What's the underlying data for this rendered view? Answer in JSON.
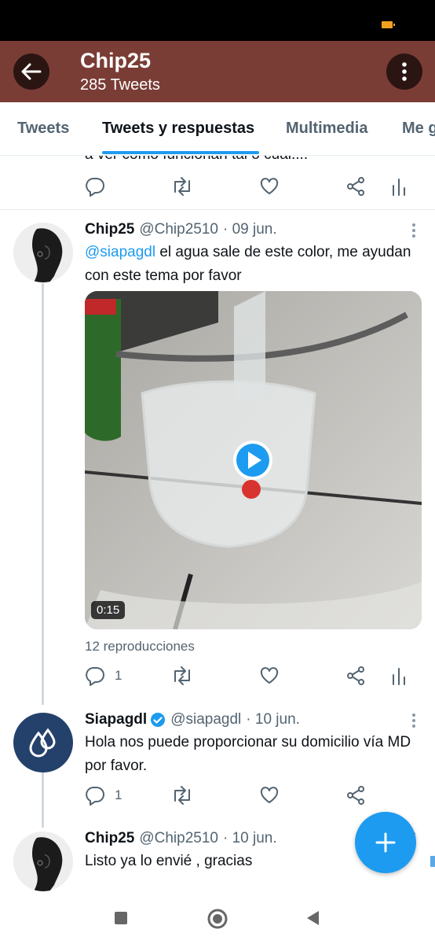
{
  "header": {
    "title": "Chip25",
    "subtitle": "285 Tweets",
    "bg_color": "#7a3d36"
  },
  "tabs": [
    {
      "label": "Tweets",
      "active": false
    },
    {
      "label": "Tweets y respuestas",
      "active": true
    },
    {
      "label": "Multimedia",
      "active": false
    },
    {
      "label": "Me g",
      "active": false
    }
  ],
  "prev_tweet": {
    "cut_text": "a ver como funcionan tal o cual...."
  },
  "tweets": [
    {
      "name": "Chip25",
      "handle": "@Chip2510",
      "date": "· 09 jun.",
      "mention": "@siapagdl",
      "text": " el agua sale de este color, me ayudan con este tema por favor",
      "video_duration": "0:15",
      "views": "12 reproducciones",
      "reply_count": "1"
    },
    {
      "name": "Siapagdl",
      "handle": "@siapagdl",
      "date": "· 10 jun.",
      "verified": true,
      "text": "Hola nos puede proporcionar su domicilio vía MD por favor.",
      "reply_count": "1"
    },
    {
      "name": "Chip25",
      "handle": "@Chip2510",
      "date": "· 10 jun.",
      "text": "Listo ya lo envié , gracias"
    }
  ],
  "colors": {
    "accent": "#1d9bf0",
    "secondary_text": "#536471",
    "divider": "#e6ecf0"
  },
  "icons": {
    "back": "arrow-left-icon",
    "more": "more-vertical-icon",
    "reply": "reply-icon",
    "retweet": "retweet-icon",
    "like": "heart-icon",
    "share": "share-icon",
    "analytics": "analytics-icon",
    "compose": "plus-icon"
  }
}
